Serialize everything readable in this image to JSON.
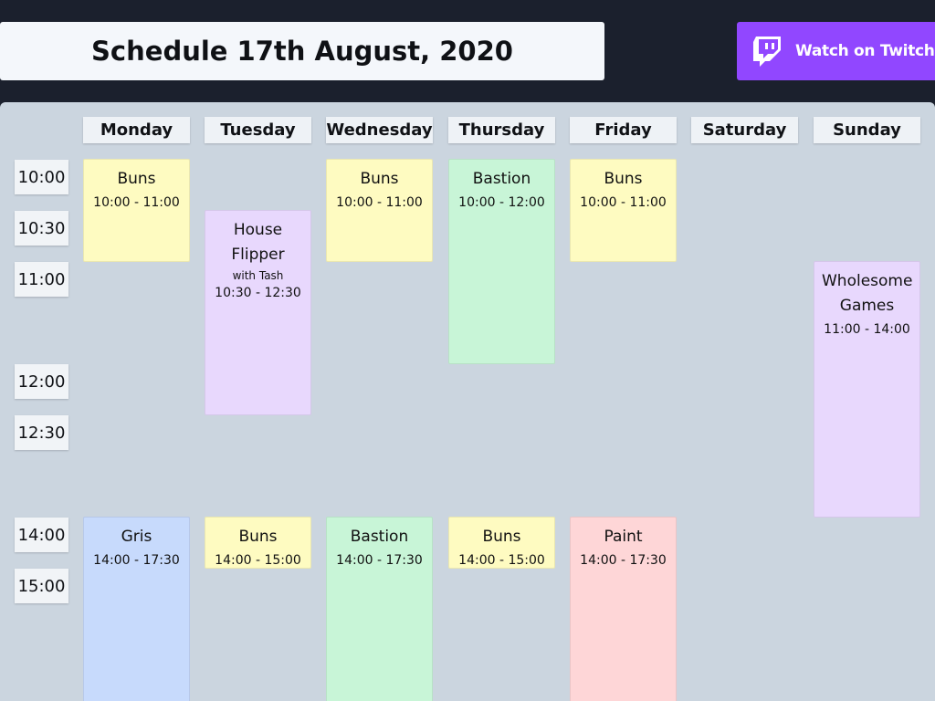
{
  "header": {
    "title": "Schedule 17th August, 2020",
    "watch_button_label": "Watch on Twitch"
  },
  "colors": {
    "background": "#1b202d",
    "board": "#cbd5df",
    "twitch_purple": "#9147ff",
    "event_yellow": "#fefbc1",
    "event_purple": "#e8d8fd",
    "event_green": "#c8f5d7",
    "event_blue": "#c7dafc",
    "event_red": "#fed6d7"
  },
  "days": [
    "Monday",
    "Tuesday",
    "Wednesday",
    "Thursday",
    "Friday",
    "Saturday",
    "Sunday"
  ],
  "times": [
    "10:00",
    "10:30",
    "11:00",
    "12:00",
    "12:30",
    "14:00",
    "15:00"
  ],
  "events": [
    {
      "day": "Monday",
      "name": "Buns",
      "time": "10:00 - 11:00",
      "color": "yellow"
    },
    {
      "day": "Tuesday",
      "name": "House Flipper",
      "sub": "with Tash",
      "time": "10:30 - 12:30",
      "color": "purple"
    },
    {
      "day": "Wednesday",
      "name": "Buns",
      "time": "10:00 - 11:00",
      "color": "yellow"
    },
    {
      "day": "Thursday",
      "name": "Bastion",
      "time": "10:00 - 12:00",
      "color": "green"
    },
    {
      "day": "Friday",
      "name": "Buns",
      "time": "10:00 - 11:00",
      "color": "yellow"
    },
    {
      "day": "Sunday",
      "name": "Wholesome Games",
      "time": "11:00 - 14:00",
      "color": "purple"
    },
    {
      "day": "Monday",
      "name": "Gris",
      "time": "14:00 - 17:30",
      "color": "blue"
    },
    {
      "day": "Tuesday",
      "name": "Buns",
      "time": "14:00 - 15:00",
      "color": "yellow"
    },
    {
      "day": "Wednesday",
      "name": "Bastion",
      "time": "14:00 - 17:30",
      "color": "green"
    },
    {
      "day": "Thursday",
      "name": "Buns",
      "time": "14:00 - 15:00",
      "color": "yellow"
    },
    {
      "day": "Friday",
      "name": "Paint",
      "time": "14:00 - 17:30",
      "color": "red"
    }
  ]
}
